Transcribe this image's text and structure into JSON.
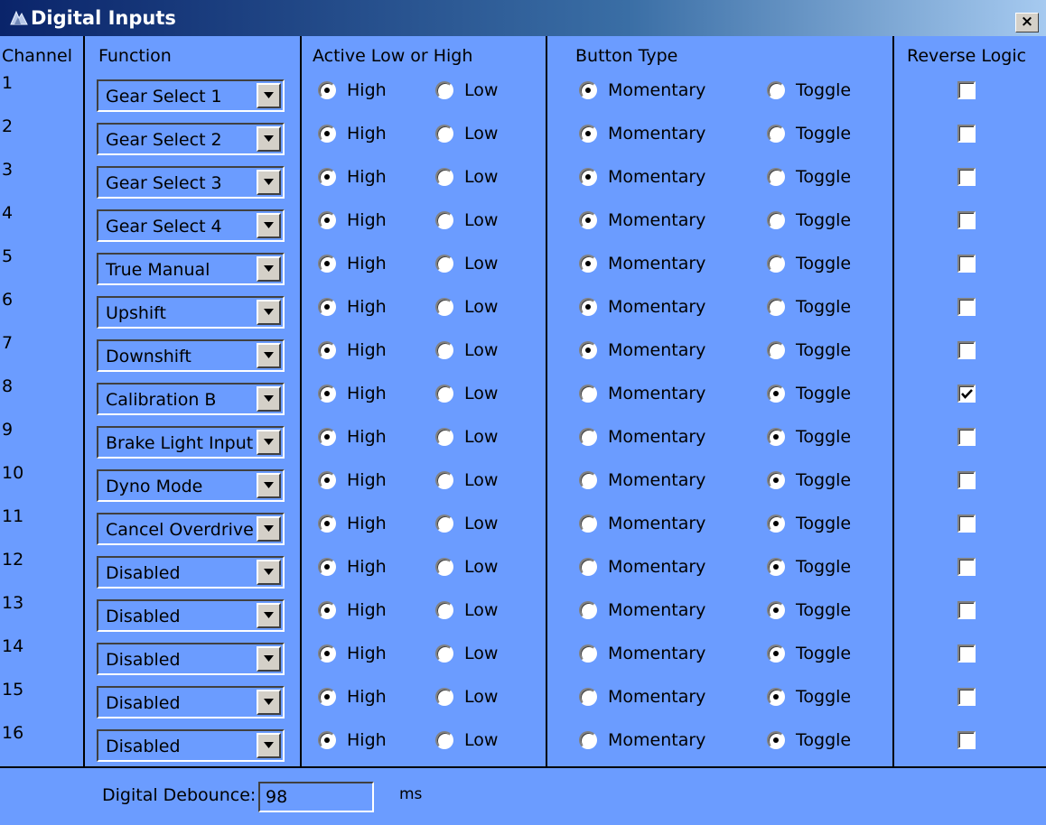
{
  "window": {
    "title": "Digital Inputs",
    "close_label": "×"
  },
  "headers": {
    "channel": "Channel",
    "function": "Function",
    "active": "Active Low or High",
    "button_type": "Button Type",
    "reverse": "Reverse Logic"
  },
  "options": {
    "high": "High",
    "low": "Low",
    "momentary": "Momentary",
    "toggle": "Toggle"
  },
  "channels": [
    {
      "num": "1",
      "function": "Gear Select 1",
      "active": "High",
      "button": "Momentary",
      "reverse": false
    },
    {
      "num": "2",
      "function": "Gear Select 2",
      "active": "High",
      "button": "Momentary",
      "reverse": false
    },
    {
      "num": "3",
      "function": "Gear Select 3",
      "active": "High",
      "button": "Momentary",
      "reverse": false
    },
    {
      "num": "4",
      "function": "Gear Select 4",
      "active": "High",
      "button": "Momentary",
      "reverse": false
    },
    {
      "num": "5",
      "function": "True Manual",
      "active": "High",
      "button": "Momentary",
      "reverse": false
    },
    {
      "num": "6",
      "function": "Upshift",
      "active": "High",
      "button": "Momentary",
      "reverse": false
    },
    {
      "num": "7",
      "function": "Downshift",
      "active": "High",
      "button": "Momentary",
      "reverse": false
    },
    {
      "num": "8",
      "function": "Calibration B",
      "active": "High",
      "button": "Toggle",
      "reverse": true
    },
    {
      "num": "9",
      "function": "Brake Light Input",
      "active": "High",
      "button": "Toggle",
      "reverse": false
    },
    {
      "num": "10",
      "function": "Dyno Mode",
      "active": "High",
      "button": "Toggle",
      "reverse": false
    },
    {
      "num": "11",
      "function": "Cancel Overdrive",
      "active": "High",
      "button": "Toggle",
      "reverse": false
    },
    {
      "num": "12",
      "function": "Disabled",
      "active": "High",
      "button": "Toggle",
      "reverse": false
    },
    {
      "num": "13",
      "function": "Disabled",
      "active": "High",
      "button": "Toggle",
      "reverse": false
    },
    {
      "num": "14",
      "function": "Disabled",
      "active": "High",
      "button": "Toggle",
      "reverse": false
    },
    {
      "num": "15",
      "function": "Disabled",
      "active": "High",
      "button": "Toggle",
      "reverse": false
    },
    {
      "num": "16",
      "function": "Disabled",
      "active": "High",
      "button": "Toggle",
      "reverse": false
    }
  ],
  "footer": {
    "debounce_label": "Digital Debounce:",
    "debounce_value": "98",
    "unit": "ms"
  }
}
